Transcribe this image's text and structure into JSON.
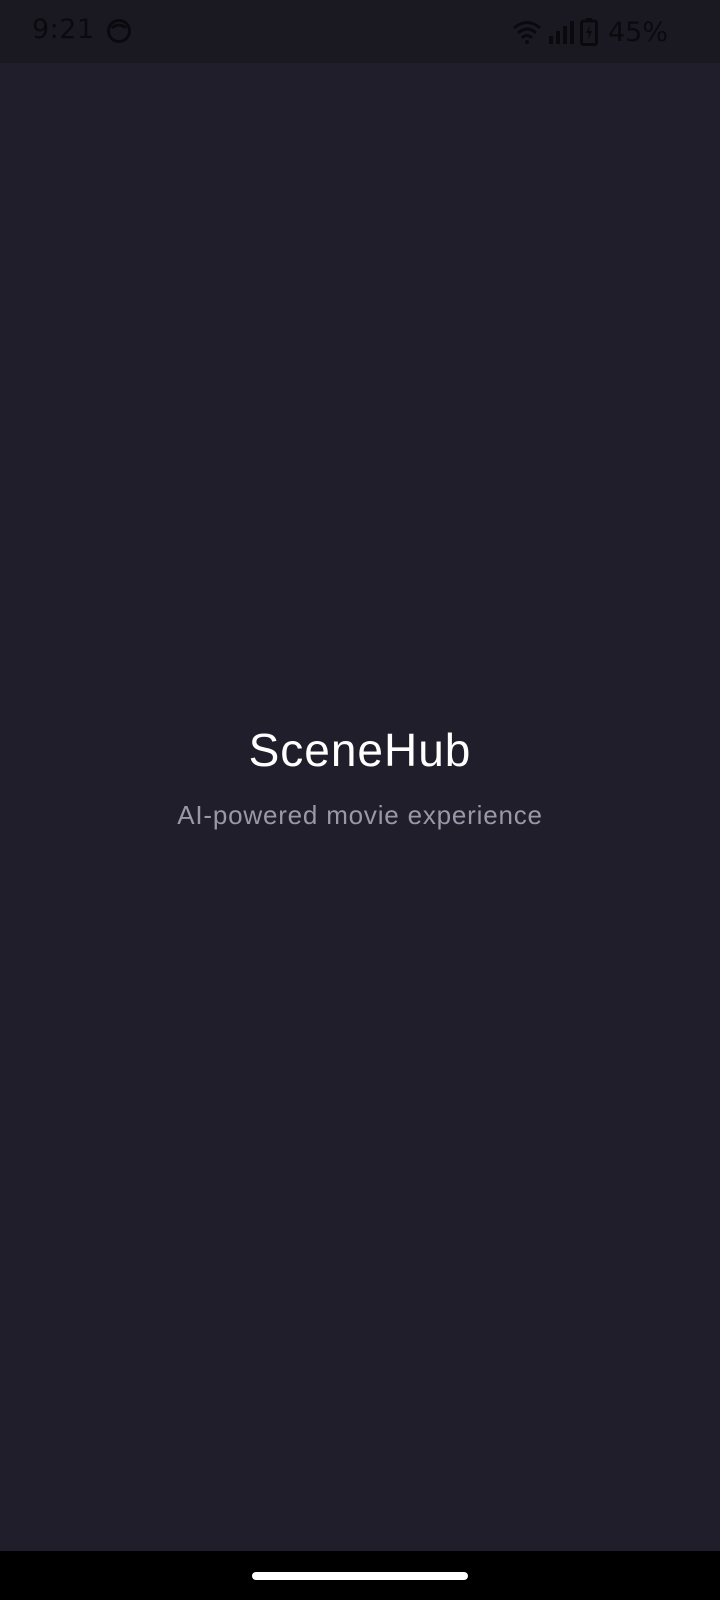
{
  "status_bar": {
    "time": "9:21",
    "battery": "45%",
    "icons": [
      "app-notification-icon",
      "wifi-icon",
      "signal-icon",
      "battery-charging-icon"
    ]
  },
  "splash": {
    "title": "SceneHub",
    "tagline": "AI-powered movie experience"
  },
  "colors": {
    "background": "#1f1e2a",
    "title": "#ffffff",
    "tagline": "#9a98a8"
  }
}
